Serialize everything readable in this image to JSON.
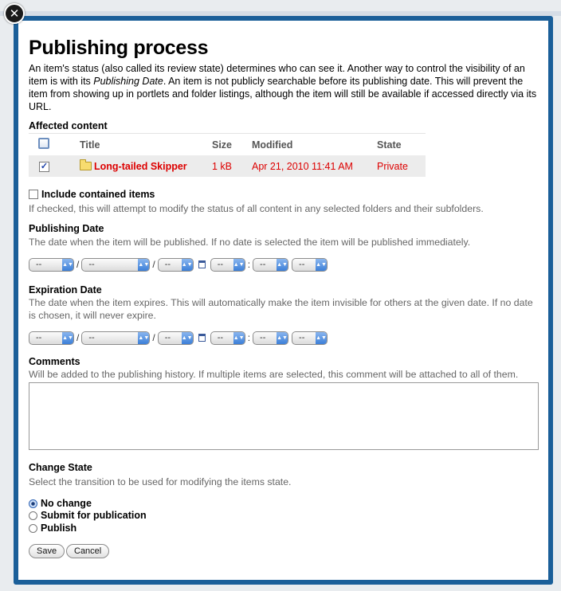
{
  "dialog": {
    "title": "Publishing process",
    "intro_1": "An item's status (also called its review state) determines who can see it. Another way to control the visibility of an item is with its ",
    "intro_em": "Publishing Date",
    "intro_2": ". An item is not publicly searchable before its publishing date. This will prevent the item from showing up in portlets and folder listings, although the item will still be available if accessed directly via its URL."
  },
  "affected": {
    "label": "Affected content",
    "columns": [
      "Title",
      "Size",
      "Modified",
      "State"
    ],
    "rows": [
      {
        "title": "Long-tailed Skipper",
        "size": "1 kB",
        "modified": "Apr 21, 2010 11:41 AM",
        "state": "Private",
        "checked": true
      }
    ]
  },
  "include_contained": {
    "label": "Include contained items",
    "help": "If checked, this will attempt to modify the status of all content in any selected folders and their subfolders."
  },
  "publishing_date": {
    "label": "Publishing Date",
    "help": "The date when the item will be published. If no date is selected the item will be published immediately.",
    "fields": [
      "--",
      "--",
      "--",
      "--",
      "--",
      "--"
    ]
  },
  "expiration_date": {
    "label": "Expiration Date",
    "help": "The date when the item expires. This will automatically make the item invisible for others at the given date. If no date is chosen, it will never expire.",
    "fields": [
      "--",
      "--",
      "--",
      "--",
      "--",
      "--"
    ]
  },
  "comments": {
    "label": "Comments",
    "help": "Will be added to the publishing history. If multiple items are selected, this comment will be attached to all of them.",
    "value": ""
  },
  "change_state": {
    "label": "Change State",
    "help": "Select the transition to be used for modifying the items state.",
    "options": [
      "No change",
      "Submit for publication",
      "Publish"
    ],
    "selected": "No change"
  },
  "buttons": {
    "save": "Save",
    "cancel": "Cancel"
  },
  "colors": {
    "frame": "#1b5f99",
    "link_red": "#dd0000",
    "row_bg": "#ececec"
  },
  "icons": {
    "close": "close-icon",
    "folder": "folder-icon",
    "calendar": "calendar-icon"
  }
}
